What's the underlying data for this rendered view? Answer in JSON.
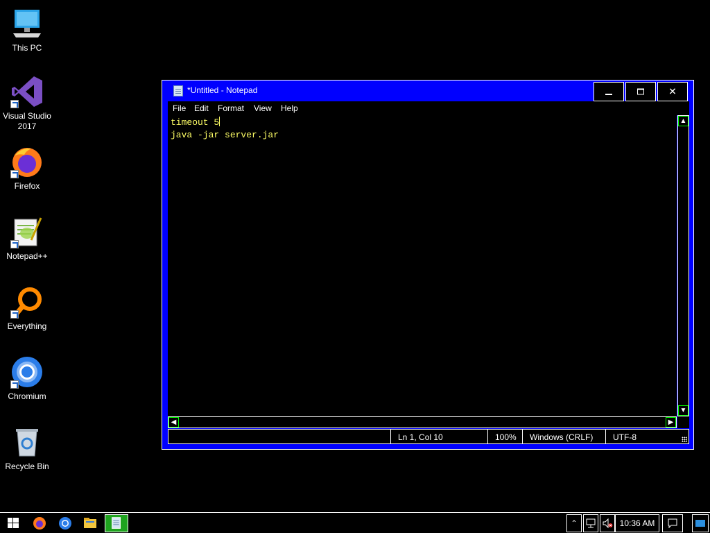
{
  "desktop": {
    "icons": [
      {
        "label": "This PC",
        "icon": "computer-icon"
      },
      {
        "label": "Visual Studio 2017",
        "icon": "visual-studio-icon"
      },
      {
        "label": "Firefox",
        "icon": "firefox-icon"
      },
      {
        "label": "Notepad++",
        "icon": "notepad-plus-plus-icon"
      },
      {
        "label": "Everything",
        "icon": "everything-search-icon"
      },
      {
        "label": "Chromium",
        "icon": "chromium-icon"
      },
      {
        "label": "Recycle Bin",
        "icon": "recycle-bin-icon"
      }
    ]
  },
  "window": {
    "title": "*Untitled - Notepad",
    "controls": {
      "minimize": "minimize",
      "maximize": "maximize",
      "close": "close"
    },
    "menu": [
      "File",
      "Edit",
      "Format",
      "View",
      "Help"
    ],
    "content": {
      "line1": "timeout 5",
      "line2": "java -jar server.jar"
    },
    "status": {
      "position": "Ln 1, Col 10",
      "zoom": "100%",
      "line_ending": "Windows (CRLF)",
      "encoding": "UTF-8"
    }
  },
  "taskbar": {
    "pinned": [
      "start-icon",
      "firefox-icon",
      "chromium-icon",
      "file-explorer-icon",
      "notepad-icon"
    ],
    "clock": "10:36 AM"
  },
  "colors": {
    "window_frame": "#0000ff",
    "text": "#ffff66",
    "desktop": "#000000",
    "active_task": "#1fa31f"
  }
}
